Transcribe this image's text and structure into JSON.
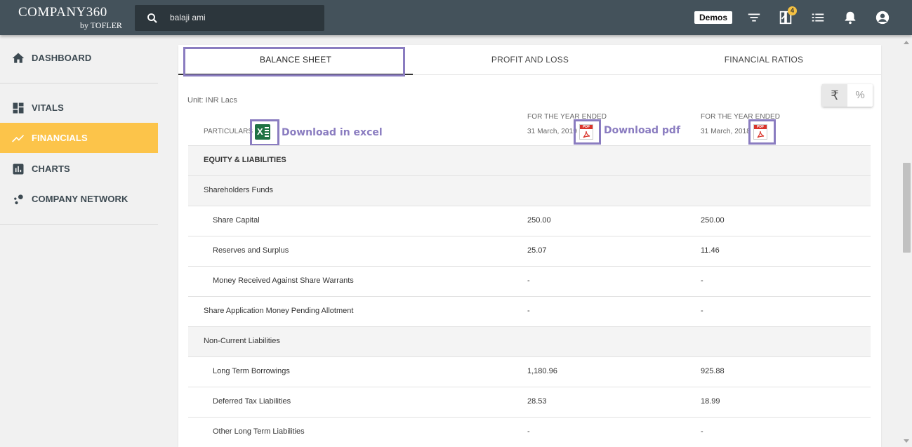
{
  "header": {
    "logo_main": "COMPANY360",
    "logo_sub": "by TOFLER",
    "search_value": "balaji ami",
    "demos_label": "Demos",
    "cart_count": "4"
  },
  "sidebar": {
    "items": [
      {
        "label": "DASHBOARD",
        "icon": "home-icon"
      },
      {
        "label": "VITALS",
        "icon": "dashboard-grid-icon"
      },
      {
        "label": "FINANCIALS",
        "icon": "trending-up-icon",
        "active": true
      },
      {
        "label": "CHARTS",
        "icon": "bar-chart-icon"
      },
      {
        "label": "COMPANY NETWORK",
        "icon": "network-icon"
      }
    ]
  },
  "tabs": [
    {
      "label": "BALANCE SHEET",
      "active": true
    },
    {
      "label": "PROFIT AND LOSS"
    },
    {
      "label": "FINANCIAL RATIOS"
    }
  ],
  "statement": {
    "unit": "Unit: INR Lacs",
    "toggle_rupee": "₹",
    "toggle_percent": "%",
    "particulars_label": "PARTICULARS",
    "period_label": "FOR THE YEAR ENDED",
    "col1_date": "31 March, 2019",
    "col2_date": "31 March, 2018",
    "annotation_excel": "Download in excel",
    "annotation_pdf": "Download pdf",
    "excel_icon_letter": "X",
    "pdf_icon_tag": "PDF"
  },
  "rows": [
    {
      "label": "EQUITY & LIABILITIES",
      "v1": "",
      "v2": "",
      "bold": true,
      "shade": true,
      "indent": 0
    },
    {
      "label": "Shareholders Funds",
      "v1": "",
      "v2": "",
      "shade": true,
      "indent": 0
    },
    {
      "label": "Share Capital",
      "v1": "250.00",
      "v2": "250.00",
      "indent": 1
    },
    {
      "label": "Reserves and Surplus",
      "v1": "25.07",
      "v2": "11.46",
      "indent": 1
    },
    {
      "label": "Money Received Against Share Warrants",
      "v1": "-",
      "v2": "-",
      "indent": 1
    },
    {
      "label": "Share Application Money Pending Allotment",
      "v1": "-",
      "v2": "-",
      "indent": 0
    },
    {
      "label": "Non-Current Liabilities",
      "v1": "",
      "v2": "",
      "shade": true,
      "indent": 0
    },
    {
      "label": "Long Term Borrowings",
      "v1": "1,180.96",
      "v2": "925.88",
      "indent": 1
    },
    {
      "label": "Deferred Tax Liabilities",
      "v1": "28.53",
      "v2": "18.99",
      "indent": 1
    },
    {
      "label": "Other Long Term Liabilities",
      "v1": "-",
      "v2": "-",
      "indent": 1
    }
  ],
  "colors": {
    "topbar": "#44525b",
    "accent": "#fcc44a",
    "highlight": "#8a7cc0"
  }
}
